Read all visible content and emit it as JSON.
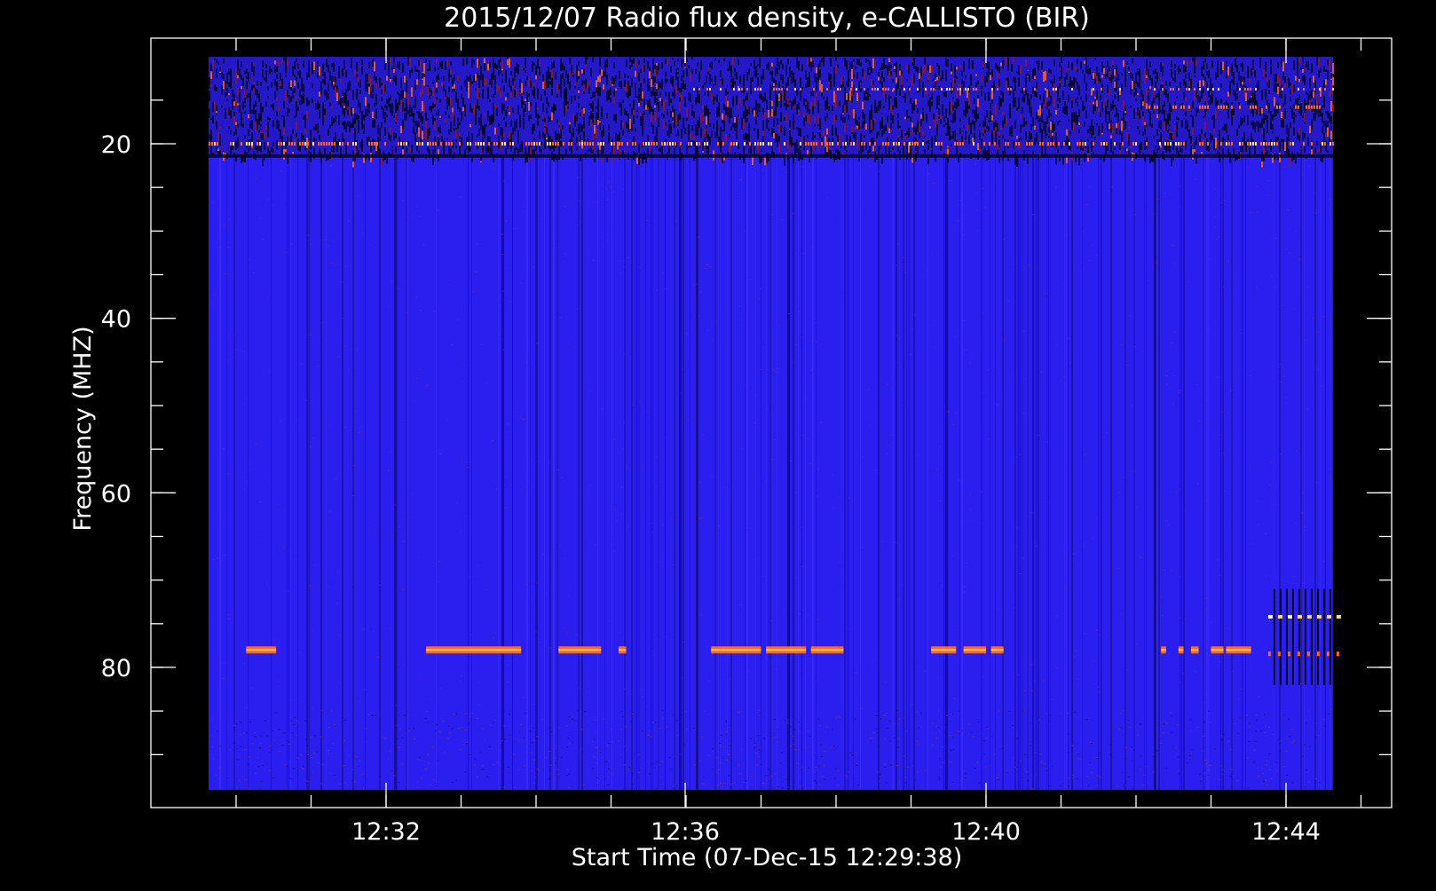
{
  "chart_data": {
    "type": "heatmap",
    "title": "2015/12/07  Radio flux density, e-CALLISTO (BIR)",
    "xlabel": "Start Time (07-Dec-15 12:29:38)",
    "ylabel": "Frequency (MHZ)",
    "x_ticks": [
      "12:32",
      "12:36",
      "12:40",
      "12:44"
    ],
    "y_ticks": [
      "20",
      "40",
      "60",
      "80"
    ],
    "x_range_minutes_after_1229": [
      0.22,
      15.3
    ],
    "y_range_mhz": [
      10.5,
      94.5
    ],
    "y_axis_inverted": true,
    "grid": false,
    "colors": {
      "background_emission": "#2b1ff0",
      "strong_emission": "#ff6a10",
      "peak_emission": "#ffe080",
      "low_emission": "#0a0530",
      "axes": "#ffffff",
      "figure_background": "#000000"
    },
    "features": [
      {
        "name": "interference band",
        "freq_mhz": [
          10.5,
          21.5
        ]
      },
      {
        "name": "narrowband emission",
        "freq_mhz": 78.0,
        "segments_time": [
          [
            "12:30:08",
            "12:30:32"
          ],
          [
            "12:32:32",
            "12:33:48"
          ],
          [
            "12:34:18",
            "12:34:52"
          ],
          [
            "12:35:06",
            "12:35:12"
          ],
          [
            "12:36:20",
            "12:37:00"
          ],
          [
            "12:37:04",
            "12:37:36"
          ],
          [
            "12:37:40",
            "12:38:06"
          ],
          [
            "12:39:16",
            "12:39:36"
          ],
          [
            "12:39:42",
            "12:40:00"
          ],
          [
            "12:40:04",
            "12:40:14"
          ],
          [
            "12:42:20",
            "12:42:24"
          ],
          [
            "12:42:34",
            "12:42:38"
          ],
          [
            "12:42:44",
            "12:42:50"
          ],
          [
            "12:43:00",
            "12:43:10"
          ],
          [
            "12:43:12",
            "12:43:32"
          ]
        ]
      },
      {
        "name": "late burst",
        "freq_mhz": [
          71,
          82
        ],
        "time": [
          "12:43:50",
          "12:44:48"
        ]
      }
    ]
  }
}
